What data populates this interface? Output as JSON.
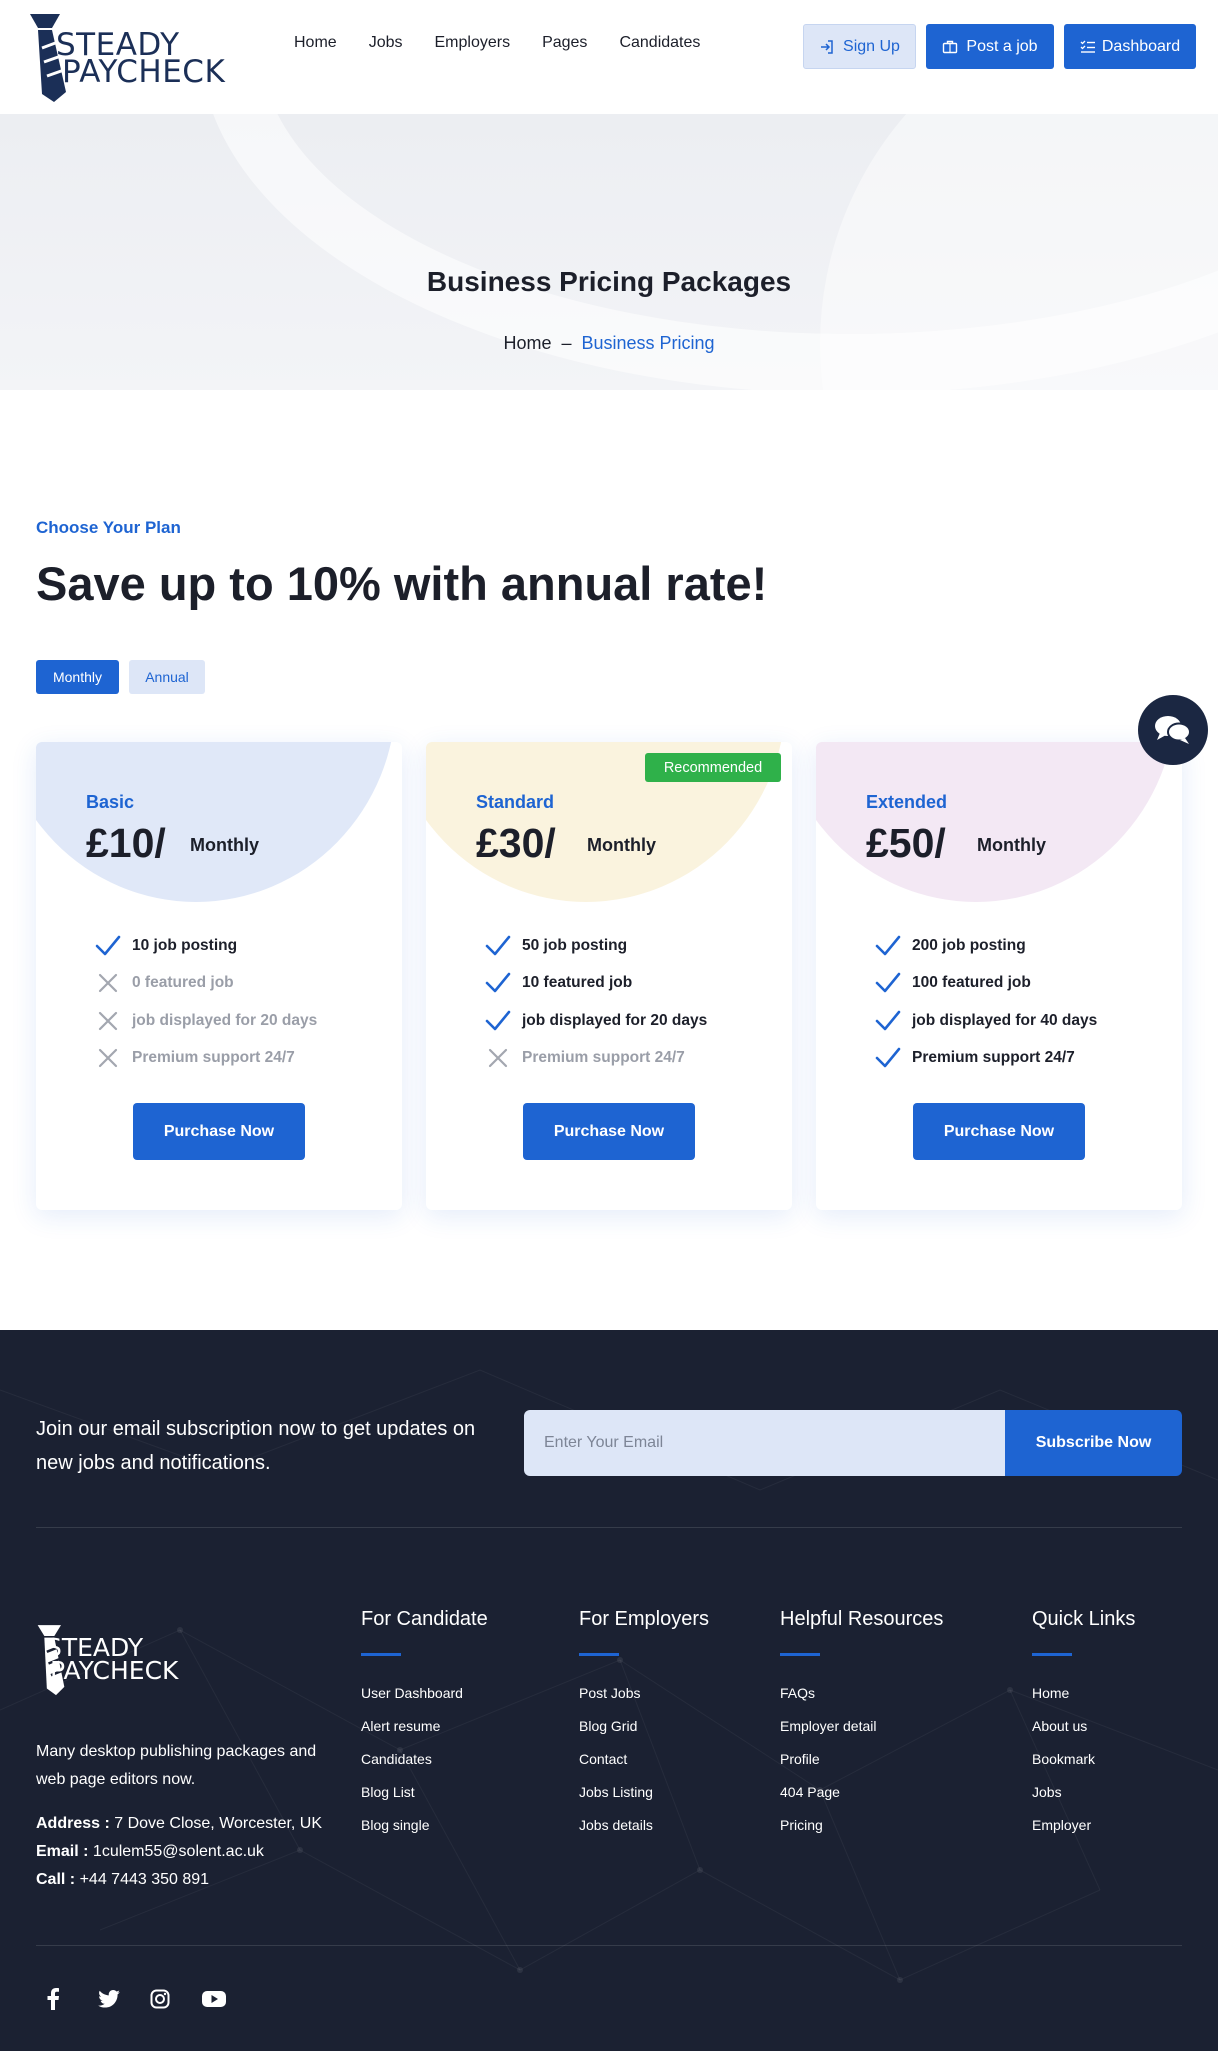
{
  "header": {
    "logo": {
      "line1": "STEADY",
      "line2": "PAYCHECK"
    },
    "nav": [
      "Home",
      "Jobs",
      "Employers",
      "Pages",
      "Candidates"
    ],
    "signup_label": "Sign Up",
    "post_job_label": "Post a job",
    "dashboard_label": "Dashboard"
  },
  "hero": {
    "title": "Business Pricing Packages",
    "breadcrumb": {
      "home": "Home",
      "separator": "–",
      "current": "Business Pricing"
    }
  },
  "pricing": {
    "eyebrow": "Choose Your Plan",
    "headline": "Save up to 10% with annual rate!",
    "toggle": {
      "monthly": "Monthly",
      "annual": "Annual",
      "active": "Monthly"
    },
    "badge": "Recommended",
    "plans": [
      {
        "name": "Basic",
        "price": "£10/",
        "period": "Monthly",
        "blob_color": "#e0e8f8",
        "features": [
          {
            "text": "10 job posting",
            "included": true
          },
          {
            "text": "0 featured job",
            "included": false
          },
          {
            "text": "job displayed for 20 days",
            "included": false
          },
          {
            "text": "Premium support 24/7",
            "included": false
          }
        ],
        "button": "Purchase Now"
      },
      {
        "name": "Standard",
        "price": "£30/",
        "period": "Monthly",
        "blob_color": "#faf3de",
        "features": [
          {
            "text": "50 job posting",
            "included": true
          },
          {
            "text": "10 featured job",
            "included": true
          },
          {
            "text": "job displayed for 20 days",
            "included": true
          },
          {
            "text": "Premium support 24/7",
            "included": false
          }
        ],
        "button": "Purchase Now"
      },
      {
        "name": "Extended",
        "price": "£50/",
        "period": "Monthly",
        "blob_color": "#f3e8f4",
        "features": [
          {
            "text": "200 job posting",
            "included": true
          },
          {
            "text": "100 featured job",
            "included": true
          },
          {
            "text": "job displayed for 40 days",
            "included": true
          },
          {
            "text": "Premium support 24/7",
            "included": true
          }
        ],
        "button": "Purchase Now"
      }
    ]
  },
  "subscribe": {
    "text": "Join our email subscription now to get updates on new jobs and notifications.",
    "placeholder": "Enter Your Email",
    "button": "Subscribe Now"
  },
  "footer": {
    "logo": {
      "line1": "STEADY",
      "line2": "PAYCHECK"
    },
    "description": "Many desktop publishing packages and web page editors now.",
    "address_label": "Address :",
    "address": "7 Dove Close, Worcester, UK",
    "email_label": "Email :",
    "email": "1culem55@solent.ac.uk",
    "call_label": "Call :",
    "call": "+44 7443 350 891",
    "columns": [
      {
        "title": "For Candidate",
        "links": [
          "User Dashboard",
          "Alert resume",
          "Candidates",
          "Blog List",
          "Blog single"
        ]
      },
      {
        "title": "For Employers",
        "links": [
          "Post Jobs",
          "Blog Grid",
          "Contact",
          "Jobs Listing",
          "Jobs details"
        ]
      },
      {
        "title": "Helpful Resources",
        "links": [
          "FAQs",
          "Employer detail",
          "Profile",
          "404 Page",
          "Pricing"
        ]
      },
      {
        "title": "Quick Links",
        "links": [
          "Home",
          "About us",
          "Bookmark",
          "Jobs",
          "Employer"
        ]
      }
    ],
    "socials": [
      "facebook-icon",
      "twitter-icon",
      "instagram-icon",
      "youtube-icon"
    ]
  },
  "colors": {
    "primary": "#1e64d2",
    "dark": "#1b2132",
    "success": "#2fb14a"
  }
}
